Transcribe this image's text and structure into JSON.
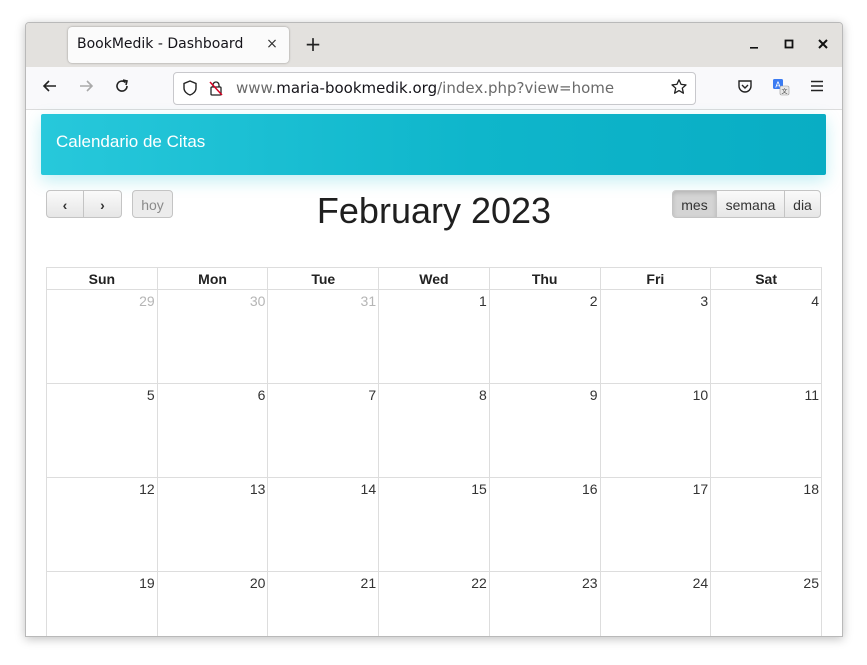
{
  "browser": {
    "tab_title": "BookMedik - Dashboard",
    "tab_close": "×",
    "new_tab": "+",
    "url_prefix": "www.",
    "url_host": "maria-bookmedik.org",
    "url_path": "/index.php?view=home"
  },
  "app": {
    "header_title": "Calendario de Citas"
  },
  "calendar": {
    "title": "February 2023",
    "prev_label": "‹",
    "next_label": "›",
    "today_label": "hoy",
    "views": {
      "month": "mes",
      "week": "semana",
      "day": "dia"
    },
    "active_view": "month",
    "weekdays": [
      "Sun",
      "Mon",
      "Tue",
      "Wed",
      "Thu",
      "Fri",
      "Sat"
    ],
    "weeks": [
      [
        "29",
        "30",
        "31",
        "1",
        "2",
        "3",
        "4"
      ],
      [
        "5",
        "6",
        "7",
        "8",
        "9",
        "10",
        "11"
      ],
      [
        "12",
        "13",
        "14",
        "15",
        "16",
        "17",
        "18"
      ],
      [
        "19",
        "20",
        "21",
        "22",
        "23",
        "24",
        "25"
      ]
    ]
  },
  "colors": {
    "header_gradient_start": "#27c8db",
    "header_gradient_end": "#09adc4",
    "grid_border": "#dddddd",
    "other_month_day": "#b5b5b5"
  }
}
